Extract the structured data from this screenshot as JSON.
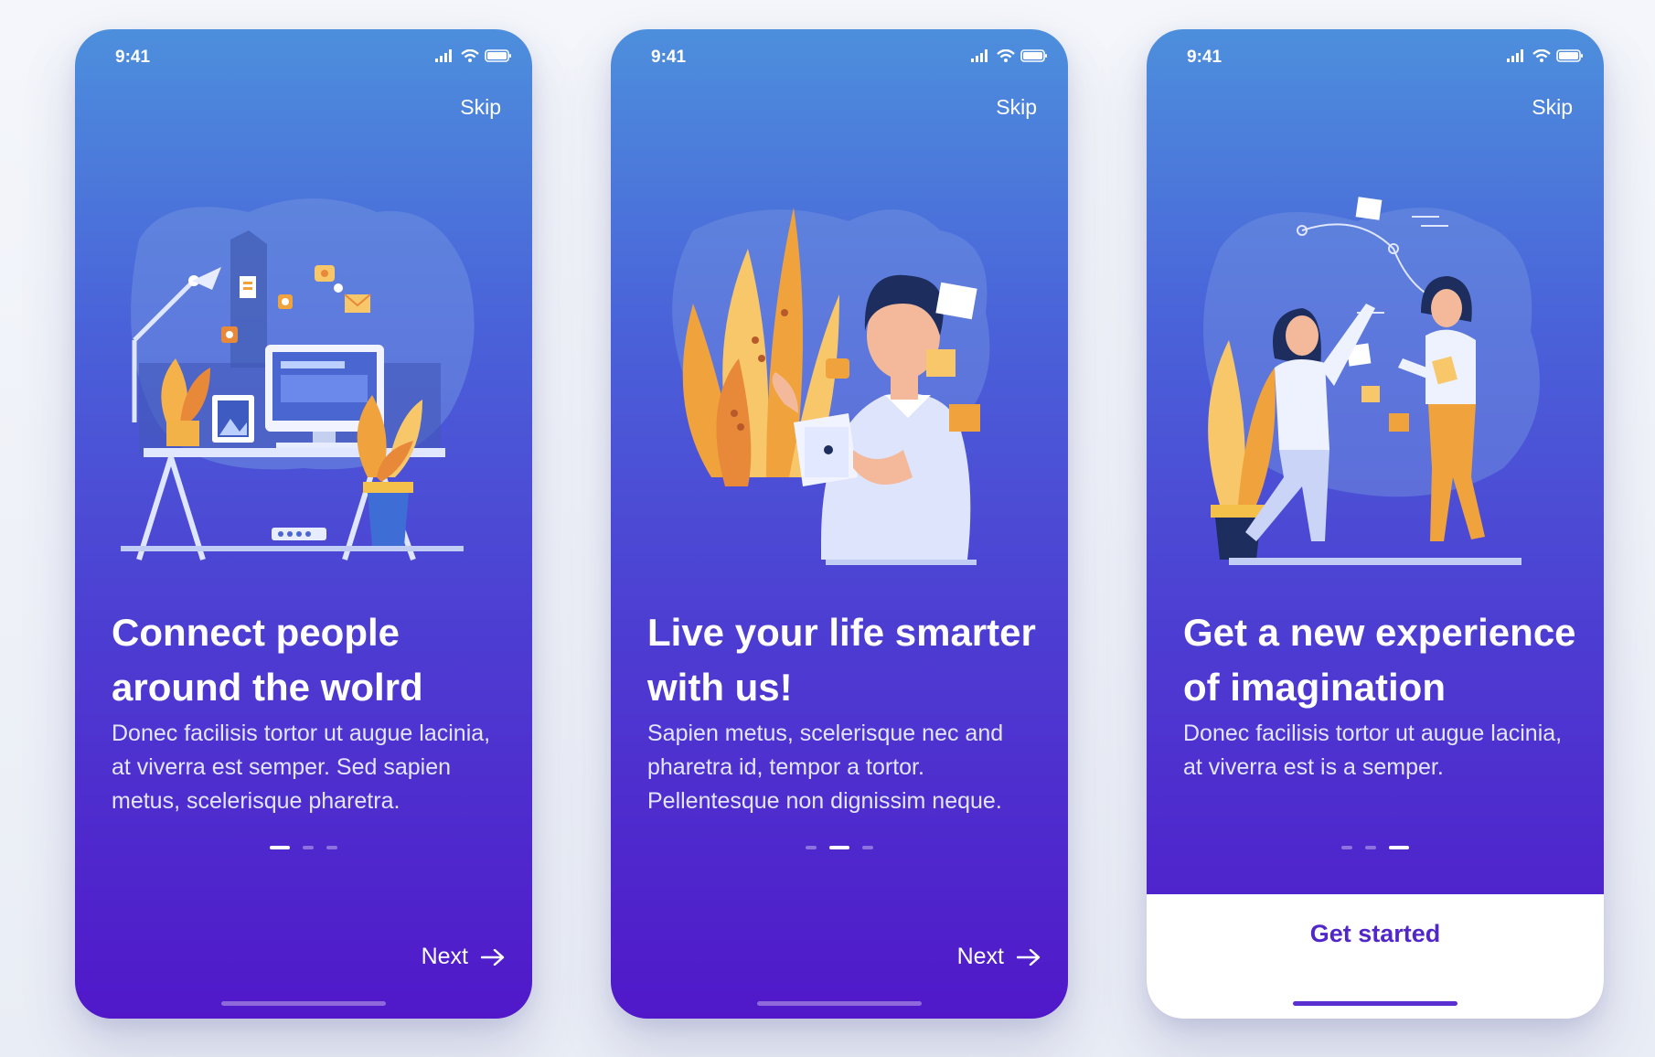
{
  "screens": [
    {
      "status": {
        "time": "9:41"
      },
      "skip_label": "Skip",
      "title": "Connect people around the wolrd",
      "body": "Donec facilisis tortor ut augue lacinia, at viverra est semper. Sed sapien metus, scelerisque pharetra.",
      "active_page": 1,
      "action_label": "Next"
    },
    {
      "status": {
        "time": "9:41"
      },
      "skip_label": "Skip",
      "title": "Live your life smarter with us!",
      "body": "Sapien metus, scelerisque nec and pharetra id, tempor a tortor. Pellentesque non dignissim neque.",
      "active_page": 2,
      "action_label": "Next"
    },
    {
      "status": {
        "time": "9:41"
      },
      "skip_label": "Skip",
      "title": "Get a new experience of imagination",
      "body": "Donec facilisis tortor ut augue lacinia, at viverra est is a semper.",
      "active_page": 3,
      "action_label": "Get started"
    }
  ],
  "page_count": 3,
  "colors": {
    "gradient_top": "#4d8fdc",
    "gradient_bottom": "#5018c9",
    "accent": "#5227c9",
    "illustration_orange": "#f0a33c"
  },
  "icons": [
    "signal-icon",
    "wifi-icon",
    "battery-icon",
    "arrow-right-icon"
  ]
}
